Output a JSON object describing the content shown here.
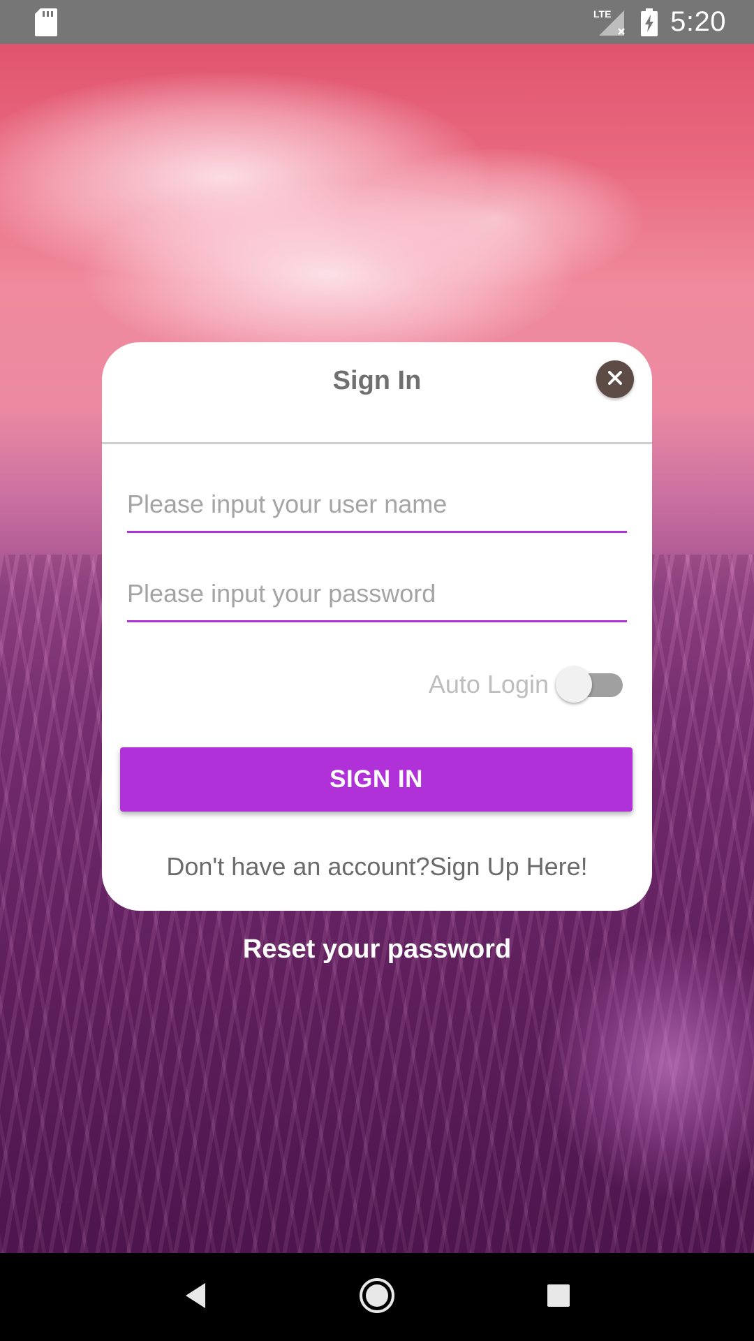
{
  "status_bar": {
    "network": "LTE",
    "time": "5:20",
    "icons": [
      "sd-card-icon",
      "signal-icon",
      "battery-charging-icon"
    ]
  },
  "dialog": {
    "title": "Sign In",
    "close_icon": "close-icon",
    "username": {
      "placeholder": "Please input your user name",
      "value": ""
    },
    "password": {
      "placeholder": "Please input your password",
      "value": ""
    },
    "auto_login": {
      "label": "Auto Login",
      "enabled": false
    },
    "signin_button": "SIGN IN",
    "signup_prompt": "Don't have an account?",
    "signup_link": "Sign Up Here!"
  },
  "reset_link": "Reset your password",
  "nav_bar": {
    "icons": [
      "back-icon",
      "home-icon",
      "recents-icon"
    ]
  },
  "colors": {
    "accent": "#b131d9",
    "status_bar": "#767676",
    "close_button": "#5d4c46",
    "text_grey": "#707070"
  }
}
